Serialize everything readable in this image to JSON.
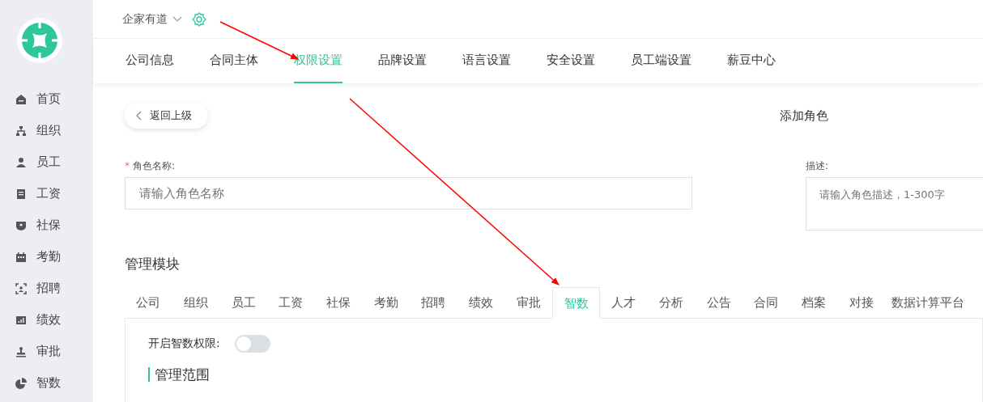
{
  "sidebar": {
    "items": [
      {
        "label": "首页"
      },
      {
        "label": "组织"
      },
      {
        "label": "员工"
      },
      {
        "label": "工资"
      },
      {
        "label": "社保"
      },
      {
        "label": "考勤"
      },
      {
        "label": "招聘"
      },
      {
        "label": "绩效"
      },
      {
        "label": "审批"
      },
      {
        "label": "智数"
      }
    ]
  },
  "header": {
    "company": "企家有道"
  },
  "nav_tabs": [
    {
      "label": "公司信息",
      "selected": false
    },
    {
      "label": "合同主体",
      "selected": false
    },
    {
      "label": "权限设置",
      "selected": true
    },
    {
      "label": "品牌设置",
      "selected": false
    },
    {
      "label": "语言设置",
      "selected": false
    },
    {
      "label": "安全设置",
      "selected": false
    },
    {
      "label": "员工端设置",
      "selected": false
    },
    {
      "label": "薪豆中心",
      "selected": false
    }
  ],
  "back_button": "返回上级",
  "page_title": "添加角色",
  "form": {
    "name_label": "角色名称:",
    "required_mark": "*",
    "name_placeholder": "请输入角色名称",
    "desc_label": "描述:",
    "desc_placeholder": "请输入角色描述，1-300字"
  },
  "modules": {
    "title": "管理模块",
    "tabs": [
      {
        "label": "公司",
        "selected": false
      },
      {
        "label": "组织",
        "selected": false
      },
      {
        "label": "员工",
        "selected": false
      },
      {
        "label": "工资",
        "selected": false
      },
      {
        "label": "社保",
        "selected": false
      },
      {
        "label": "考勤",
        "selected": false
      },
      {
        "label": "招聘",
        "selected": false
      },
      {
        "label": "绩效",
        "selected": false
      },
      {
        "label": "审批",
        "selected": false
      },
      {
        "label": "智数",
        "selected": true
      },
      {
        "label": "人才",
        "selected": false
      },
      {
        "label": "分析",
        "selected": false
      },
      {
        "label": "公告",
        "selected": false
      },
      {
        "label": "合同",
        "selected": false
      },
      {
        "label": "档案",
        "selected": false
      },
      {
        "label": "对接",
        "selected": false
      },
      {
        "label": "数据计算平台",
        "selected": false
      }
    ],
    "toggle_label": "开启智数权限:",
    "toggle_on": false,
    "scope_title": "管理范围"
  },
  "annotations": [
    {
      "kind": "arrow"
    },
    {
      "kind": "arrow"
    }
  ]
}
